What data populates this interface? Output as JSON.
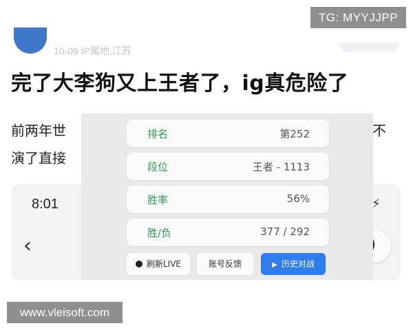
{
  "watermarks": {
    "top": "TG: MYYJJPP",
    "bottom": "www.vleisoft.com"
  },
  "post": {
    "meta": "10-09  IP属地:江苏",
    "headline": "完了大李狗又上王者了，ig真危险了",
    "body_line1": "前两年世",
    "body_line1_tail": "不",
    "body_line2": "演了直接"
  },
  "phone": {
    "time": "8:01",
    "back_icon": "chevron-left-icon",
    "flash_icon": "flash-icon"
  },
  "stats": {
    "rank": {
      "label": "排名",
      "value": "第252"
    },
    "tier": {
      "label": "段位",
      "value": "王者 - 1113"
    },
    "winrate": {
      "label": "胜率",
      "value": "56%"
    },
    "record": {
      "label": "胜/负",
      "value": "377 / 292"
    }
  },
  "buttons": {
    "refresh": "刷新LIVE",
    "feedback": "账号反馈",
    "history": "历史对战"
  },
  "colors": {
    "label_green": "#2e9b55",
    "primary_blue": "#2f7bf0",
    "watermark_gray": "#8f8f8f"
  }
}
